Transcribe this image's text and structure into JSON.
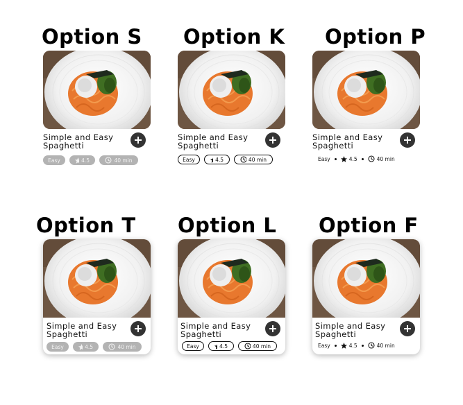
{
  "options": [
    {
      "label": "Option S",
      "recipe_line1": "Simple and Easy",
      "recipe_line2": "Spaghetti",
      "difficulty": "Easy",
      "rating": "4.5",
      "time": "40 min"
    },
    {
      "label": "Option K",
      "recipe_line1": "Simple and Easy",
      "recipe_line2": "Spaghetti",
      "difficulty": "Easy",
      "rating": "4.5",
      "time": "40 min"
    },
    {
      "label": "Option P",
      "recipe_line1": "Simple and Easy",
      "recipe_line2": "Spaghetti",
      "difficulty": "Easy",
      "rating": "4.5",
      "time": "40 min"
    },
    {
      "label": "Option T",
      "recipe_line1": "Simple and Easy",
      "recipe_line2": "Spaghetti",
      "difficulty": "Easy",
      "rating": "4.5",
      "time": "40 min"
    },
    {
      "label": "Option L",
      "recipe_line1": "Simple and Easy",
      "recipe_line2": "Spaghetti",
      "difficulty": "Easy",
      "rating": "4.5",
      "time": "40 min"
    },
    {
      "label": "Option F",
      "recipe_line1": "Simple and Easy",
      "recipe_line2": "Spaghetti",
      "difficulty": "Easy",
      "rating": "4.5",
      "time": "40 min"
    }
  ],
  "icons": {
    "add": "plus-circle-icon",
    "rating": "star-icon",
    "time": "clock-icon"
  },
  "colors": {
    "add_button": "#333333",
    "chip_filled": "#b3b3b3",
    "chip_outline": "#111111"
  }
}
